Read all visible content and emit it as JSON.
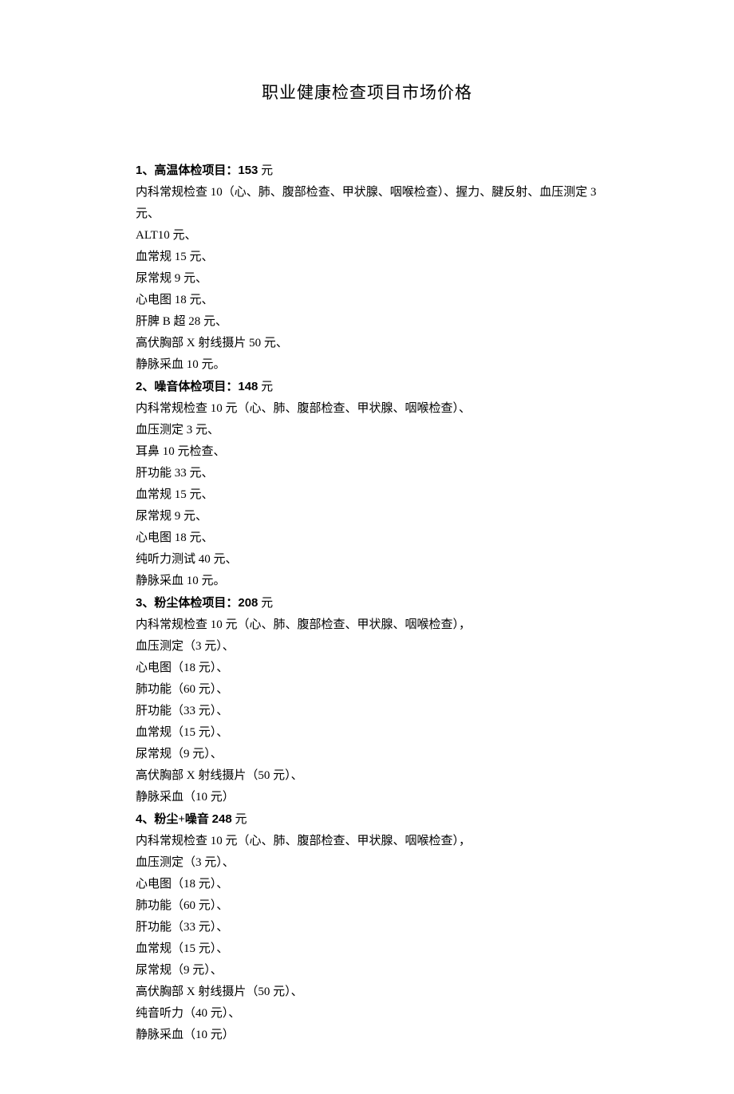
{
  "title": "职业健康检查项目市场价格",
  "sections": [
    {
      "num": "1",
      "label": "、高温体检项目：",
      "price": "153",
      "unit": " 元",
      "lines": [
        "内科常规检查 10（心、肺、腹部检查、甲状腺、咽喉检查）、握力、腱反射、血压测定 3 元、",
        "ALT10 元、",
        "血常规 15 元、",
        "尿常规 9 元、",
        "心电图 18 元、",
        "肝脾 B 超 28 元、",
        "高伏胸部 X 射线摄片 50 元、",
        "静脉采血 10 元。"
      ]
    },
    {
      "num": "2",
      "label": "、噪音体检项目：",
      "price": "148",
      "unit": " 元",
      "lines": [
        "内科常规检查 10 元（心、肺、腹部检查、甲状腺、咽喉检查）、",
        "血压测定 3 元、",
        "耳鼻 10 元检查、",
        "肝功能 33 元、",
        "血常规 15 元、",
        "尿常规 9 元、",
        "心电图 18 元、",
        "纯听力测试 40 元、",
        "静脉采血 10 元。"
      ]
    },
    {
      "num": "3",
      "label": "、粉尘体检项目：",
      "price": "208",
      "unit": " 元",
      "lines": [
        "内科常规检查 10 元（心、肺、腹部检查、甲状腺、咽喉检查），",
        "血压测定（3 元）、",
        "心电图（18 元）、",
        "肺功能（60 元）、",
        "肝功能（33 元）、",
        "血常规（15 元）、",
        "尿常规（9 元）、",
        "高伏胸部 X 射线摄片（50 元）、",
        "静脉采血（10 元）"
      ]
    },
    {
      "num": "4",
      "label": "、粉尘+噪音 ",
      "price": "248",
      "unit": " 元",
      "lines": [
        "内科常规检查 10 元（心、肺、腹部检查、甲状腺、咽喉检查），",
        "血压测定（3 元）、",
        "心电图（18 元）、",
        "肺功能（60 元）、",
        "肝功能（33 元）、",
        "血常规（15 元）、",
        "尿常规（9 元）、",
        "高伏胸部 X 射线摄片（50 元）、",
        "纯音听力（40 元）、",
        "静脉采血（10 元）"
      ]
    }
  ]
}
